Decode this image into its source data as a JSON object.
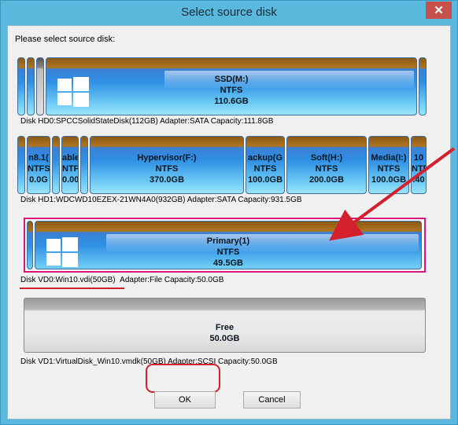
{
  "window": {
    "title": "Select source disk",
    "close_glyph": "✕"
  },
  "prompt": "Please select source disk:",
  "disks": [
    {
      "info": "Disk HD0:SPCCSolidStateDisk(112GB)  Adapter:SATA  Capacity:111.8GB",
      "partitions": [
        {
          "name": "SSD(M:)",
          "fs": "NTFS",
          "size": "110.6GB",
          "icon": "windows-logo"
        }
      ]
    },
    {
      "info": "Disk HD1:WDCWD10EZEX-21WN4A0(932GB)  Adapter:SATA  Capacity:931.5GB",
      "partitions": [
        {
          "name": "n8.1(",
          "fs": "NTFS",
          "size": "0.0G"
        },
        {
          "name": "able",
          "fs": "NTFS",
          "size": "0.00"
        },
        {
          "name": "Hypervisor(F:)",
          "fs": "NTFS",
          "size": "370.0GB"
        },
        {
          "name": "ackup(G",
          "fs": "NTFS",
          "size": "100.0GB"
        },
        {
          "name": "Soft(H:)",
          "fs": "NTFS",
          "size": "200.0GB"
        },
        {
          "name": "Media(I:)",
          "fs": "NTFS",
          "size": "100.0GB"
        },
        {
          "name": "10",
          "fs": "NTFS",
          "size": ".40"
        }
      ]
    },
    {
      "info_disk": "Disk VD0:Win10.vdi(50GB)",
      "info_rest": "Adapter:File  Capacity:50.0GB",
      "partitions": [
        {
          "name": "Primary(1)",
          "fs": "NTFS",
          "size": "49.5GB",
          "icon": "windows-logo"
        }
      ]
    },
    {
      "info": "Disk VD1:VirtualDisk_Win10.vmdk(50GB)  Adapter:SCSI  Capacity:50.0GB",
      "partitions": [
        {
          "name": "Free",
          "size": "50.0GB"
        }
      ]
    }
  ],
  "buttons": {
    "ok": "OK",
    "cancel": "Cancel"
  },
  "colors": {
    "accent_red": "#d3202c",
    "selected_border": "#d4167a",
    "title_bar": "#5ab8dd"
  }
}
